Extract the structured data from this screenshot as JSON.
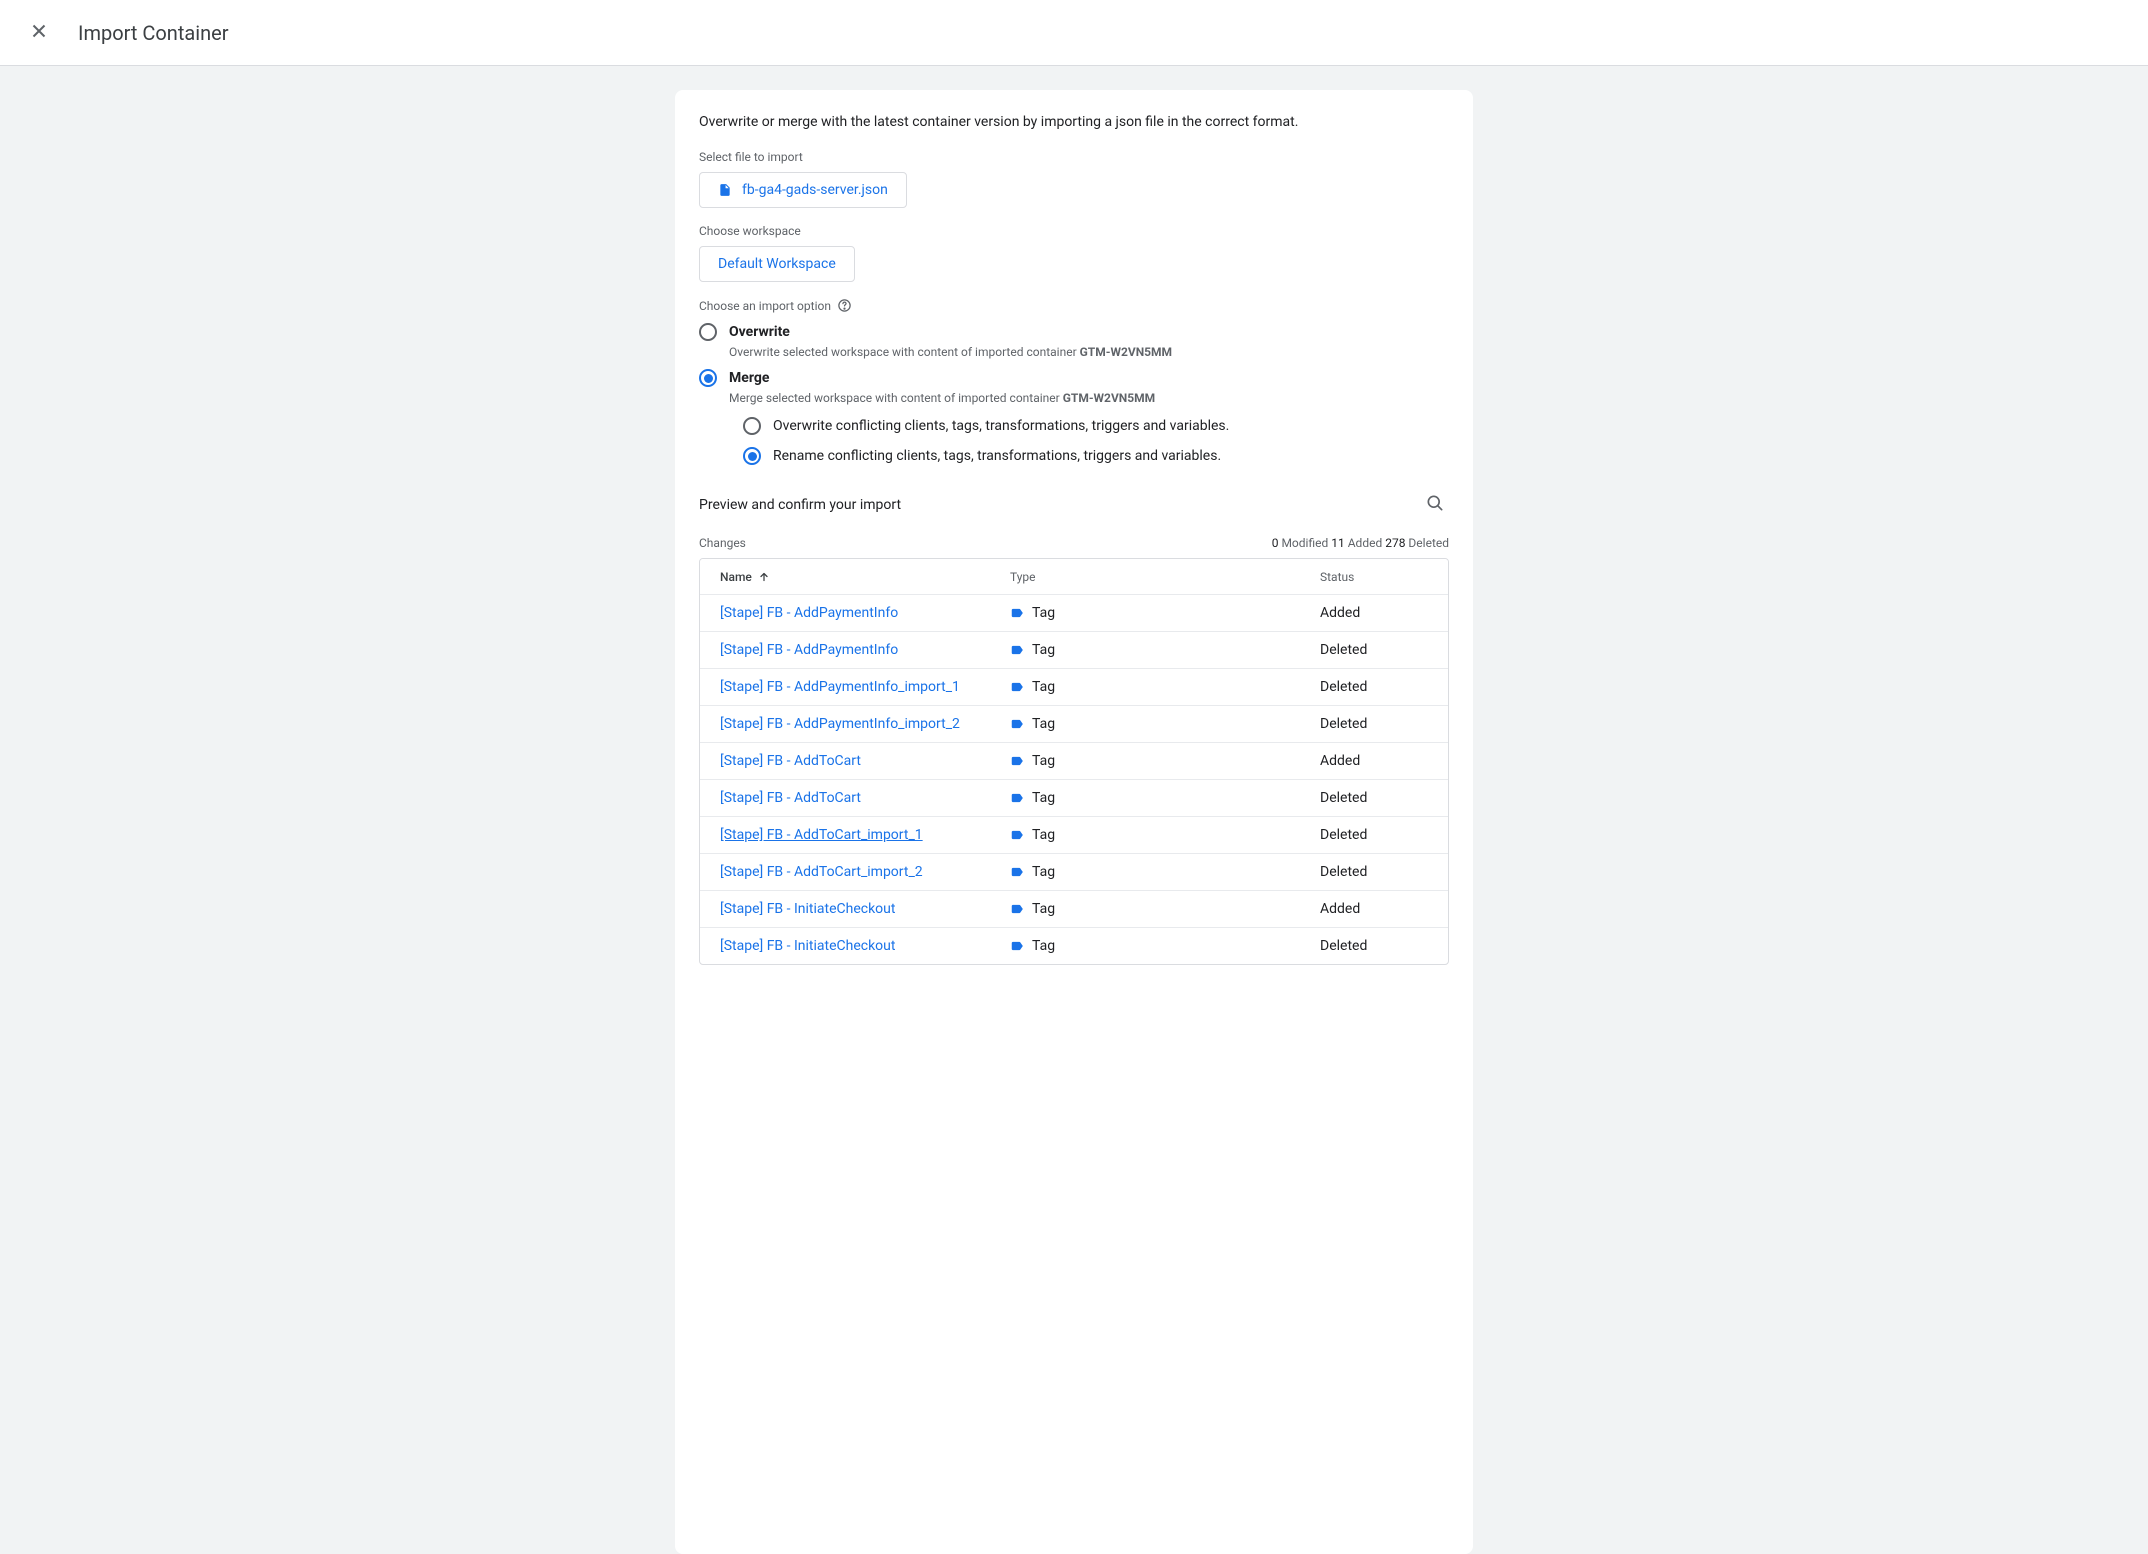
{
  "header": {
    "title": "Import Container"
  },
  "intro": "Overwrite or merge with the latest container version by importing a json file in the correct format.",
  "file": {
    "label": "Select file to import",
    "name": "fb-ga4-gads-server.json"
  },
  "workspace": {
    "label": "Choose workspace",
    "value": "Default Workspace"
  },
  "options": {
    "label": "Choose an import option",
    "overwrite": {
      "title": "Overwrite",
      "desc_pre": "Overwrite selected workspace with content of imported container ",
      "id": "GTM-W2VN5MM"
    },
    "merge": {
      "title": "Merge",
      "desc_pre": "Merge selected workspace with content of imported container ",
      "id": "GTM-W2VN5MM"
    },
    "sub_overwrite": "Overwrite conflicting clients, tags, transformations, triggers and variables.",
    "sub_rename": "Rename conflicting clients, tags, transformations, triggers and variables."
  },
  "preview": {
    "title": "Preview and confirm your import",
    "changes_label": "Changes",
    "stats": {
      "modified_n": "0",
      "modified": "Modified",
      "added_n": "11",
      "added": "Added",
      "deleted_n": "278",
      "deleted": "Deleted"
    },
    "cols": {
      "name": "Name",
      "type": "Type",
      "status": "Status"
    },
    "rows": [
      {
        "name": "[Stape] FB - AddPaymentInfo",
        "type": "Tag",
        "status": "Added"
      },
      {
        "name": "[Stape] FB - AddPaymentInfo",
        "type": "Tag",
        "status": "Deleted"
      },
      {
        "name": "[Stape] FB - AddPaymentInfo_import_1",
        "type": "Tag",
        "status": "Deleted"
      },
      {
        "name": "[Stape] FB - AddPaymentInfo_import_2",
        "type": "Tag",
        "status": "Deleted"
      },
      {
        "name": "[Stape] FB - AddToCart",
        "type": "Tag",
        "status": "Added"
      },
      {
        "name": "[Stape] FB - AddToCart",
        "type": "Tag",
        "status": "Deleted"
      },
      {
        "name": "[Stape] FB - AddToCart_import_1",
        "type": "Tag",
        "status": "Deleted",
        "under": true
      },
      {
        "name": "[Stape] FB - AddToCart_import_2",
        "type": "Tag",
        "status": "Deleted"
      },
      {
        "name": "[Stape] FB - InitiateCheckout",
        "type": "Tag",
        "status": "Added"
      },
      {
        "name": "[Stape] FB - InitiateCheckout",
        "type": "Tag",
        "status": "Deleted"
      }
    ]
  }
}
